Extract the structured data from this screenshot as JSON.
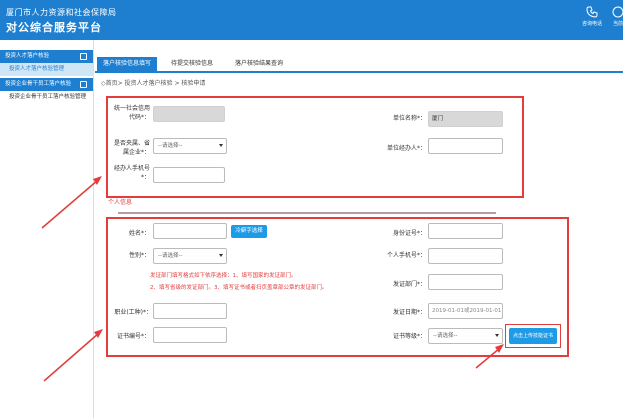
{
  "header": {
    "brand_line1": "厦门市人力资源和社会保障局",
    "brand_line2": "对公综合服务平台",
    "icons": [
      {
        "name": "phone-icon",
        "label": "咨询电话"
      },
      {
        "name": "help-icon",
        "label": "当前"
      }
    ]
  },
  "sidebar": {
    "groups": [
      {
        "label": "投资人才落户核验",
        "items": [
          {
            "label": "投资人才落户核验管理",
            "active": true
          }
        ]
      },
      {
        "label": "投资企业骨干员工落户核验",
        "items": [
          {
            "label": "投资企业骨干员工落户核验管理",
            "active": false
          }
        ]
      }
    ]
  },
  "tabs": [
    {
      "label": "落户核验信息填写",
      "active": true
    },
    {
      "label": "待提交核验信息",
      "active": false
    },
    {
      "label": "落户核验结果查询",
      "active": false
    }
  ],
  "breadcrumb": "◇首页> 投资人才落户核验 > 核验申请",
  "unit_section": {
    "credit_code_label": "统一社会信用代码*：",
    "unit_name_label": "单位名称*：",
    "unit_name_value": "厦门",
    "central_label": "是否央属、省属企业*：",
    "central_select": "--请选择--",
    "handler_label": "单位经办人*：",
    "handler_phone_label": "经办人手机号*："
  },
  "personal_title": "个人信息",
  "personal_section": {
    "name_label": "姓名*：",
    "rare_char_button": "冷僻字选择",
    "id_label": "身份证号*：",
    "gender_label": "性别*：",
    "gender_select": "--请选择--",
    "mobile_label": "个人手机号*：",
    "note_line1": "发证部门填写格式如下依序选择：1、填写国家的发证部门。",
    "note_line2": "2、填写省级的发证部门。3、填写证书或者扫页盖章部公章的发证部门。",
    "issuer_label": "发证部门*：",
    "title_label": "职业(工种)*：",
    "issue_date_label": "发证日期*：",
    "issue_date_placeholder": "2019-01-01或2019-01-01",
    "cert_no_label": "证书编号*：",
    "cert_level_label": "证书等级*：",
    "cert_level_select": "--请选择--",
    "upload_button": "点击上传技能证书"
  },
  "colors": {
    "primary": "#1e7fd0",
    "highlight": "#e23c3c"
  }
}
